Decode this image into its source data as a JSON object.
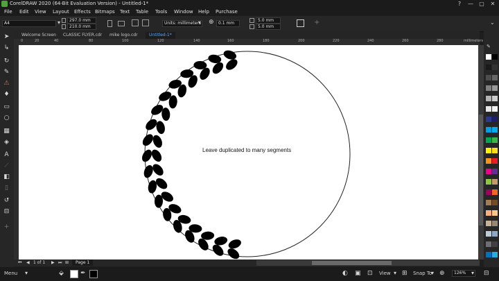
{
  "window": {
    "title": "CorelDRAW 2020 (64-Bit Evaluation Version) - Untitled-1*",
    "controls": [
      "?",
      "—",
      "▢",
      "✕"
    ]
  },
  "menu": [
    "File",
    "Edit",
    "View",
    "Layout",
    "Effects",
    "Bitmaps",
    "Text",
    "Table",
    "Tools",
    "Window",
    "Help",
    "Purchase"
  ],
  "property_bar": {
    "page_size": "A4",
    "width": "297.0 mm",
    "height": "210.0 mm",
    "units_label": "Units:",
    "units_value": "millimeters",
    "nudge": "0.1 mm",
    "dup_x": "5.0 mm",
    "dup_y": "5.0 mm"
  },
  "tabs": [
    "Welcome Screen",
    "CLASSIC FLYER.cdr",
    "mike logo.cdr",
    "Untitled-1*"
  ],
  "active_tab": 3,
  "ruler": {
    "ticks": [
      "0",
      "20",
      "40",
      "60",
      "80",
      "100",
      "120",
      "140",
      "160",
      "180",
      "200",
      "220",
      "240",
      "260",
      "280"
    ],
    "unit": "millimeters"
  },
  "canvas": {
    "caption": "Leave duplicated to many segments"
  },
  "page_nav": {
    "page_label": "Page 1"
  },
  "status": {
    "menu": "Menu",
    "view": "View",
    "snap": "Snap To",
    "zoom": "126%"
  },
  "palette_colors": [
    "#ffffff",
    "#000000",
    "#1a1a1a",
    "#333333",
    "#4d4d4d",
    "#666666",
    "#808080",
    "#999999",
    "#b3b3b3",
    "#cccccc",
    "#e6e6e6",
    "#f2f2f2",
    "#2b3a8c",
    "#1d1f6b",
    "#00a0e3",
    "#00aeef",
    "#00a651",
    "#39b54a",
    "#fff200",
    "#ffde17",
    "#f7941d",
    "#ed1c24",
    "#ec008c",
    "#662d91",
    "#8dc63f",
    "#c49a6c",
    "#9e005d",
    "#f26522",
    "#a67c52",
    "#754c24",
    "#f9ad81",
    "#fdc689",
    "#c7b299",
    "#998675",
    "#bdccd4",
    "#8fa8c8",
    "#6d6e71",
    "#414042",
    "#0072bc",
    "#29abe2"
  ]
}
